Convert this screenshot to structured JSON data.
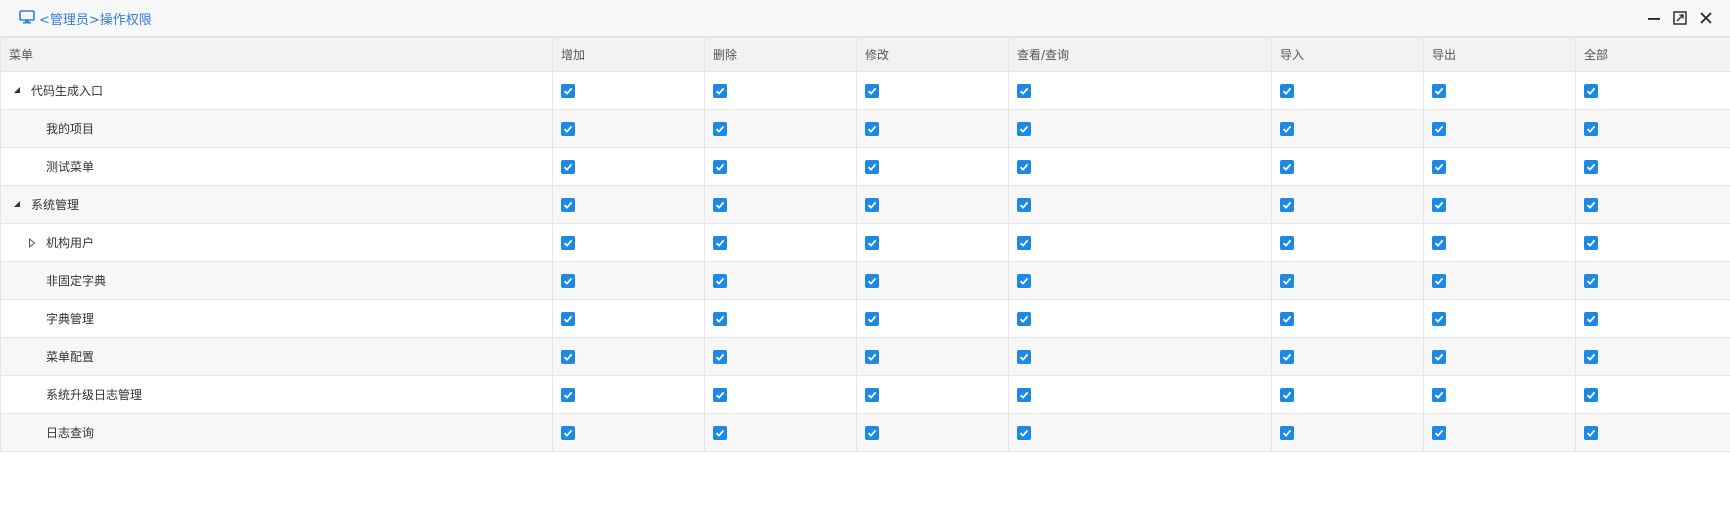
{
  "window": {
    "title": "<管理员>操作权限",
    "icon": "monitor-icon",
    "accent": "#2f7de1",
    "controls": [
      "minimize-icon",
      "maximize-icon",
      "close-icon"
    ]
  },
  "table": {
    "headers": [
      "菜单",
      "增加",
      "删除",
      "修改",
      "查看/查询",
      "导入",
      "导出",
      "全部"
    ],
    "check_color": "#1e88e5",
    "rows": [
      {
        "name": "代码生成入口",
        "level": 0,
        "toggle": "expanded",
        "checks": [
          true,
          true,
          true,
          true,
          true,
          true,
          true
        ]
      },
      {
        "name": "我的项目",
        "level": 1,
        "toggle": "none",
        "checks": [
          true,
          true,
          true,
          true,
          true,
          true,
          true
        ]
      },
      {
        "name": "测试菜单",
        "level": 1,
        "toggle": "none",
        "checks": [
          true,
          true,
          true,
          true,
          true,
          true,
          true
        ]
      },
      {
        "name": "系统管理",
        "level": 0,
        "toggle": "expanded",
        "checks": [
          true,
          true,
          true,
          true,
          true,
          true,
          true
        ]
      },
      {
        "name": "机构用户",
        "level": 1,
        "toggle": "collapsed",
        "checks": [
          true,
          true,
          true,
          true,
          true,
          true,
          true
        ]
      },
      {
        "name": "非固定字典",
        "level": 1,
        "toggle": "none",
        "checks": [
          true,
          true,
          true,
          true,
          true,
          true,
          true
        ]
      },
      {
        "name": "字典管理",
        "level": 1,
        "toggle": "none",
        "checks": [
          true,
          true,
          true,
          true,
          true,
          true,
          true
        ]
      },
      {
        "name": "菜单配置",
        "level": 1,
        "toggle": "none",
        "checks": [
          true,
          true,
          true,
          true,
          true,
          true,
          true
        ]
      },
      {
        "name": "系统升级日志管理",
        "level": 1,
        "toggle": "none",
        "checks": [
          true,
          true,
          true,
          true,
          true,
          true,
          true
        ]
      },
      {
        "name": "日志查询",
        "level": 1,
        "toggle": "none",
        "checks": [
          true,
          true,
          true,
          true,
          true,
          true,
          true
        ]
      }
    ]
  }
}
